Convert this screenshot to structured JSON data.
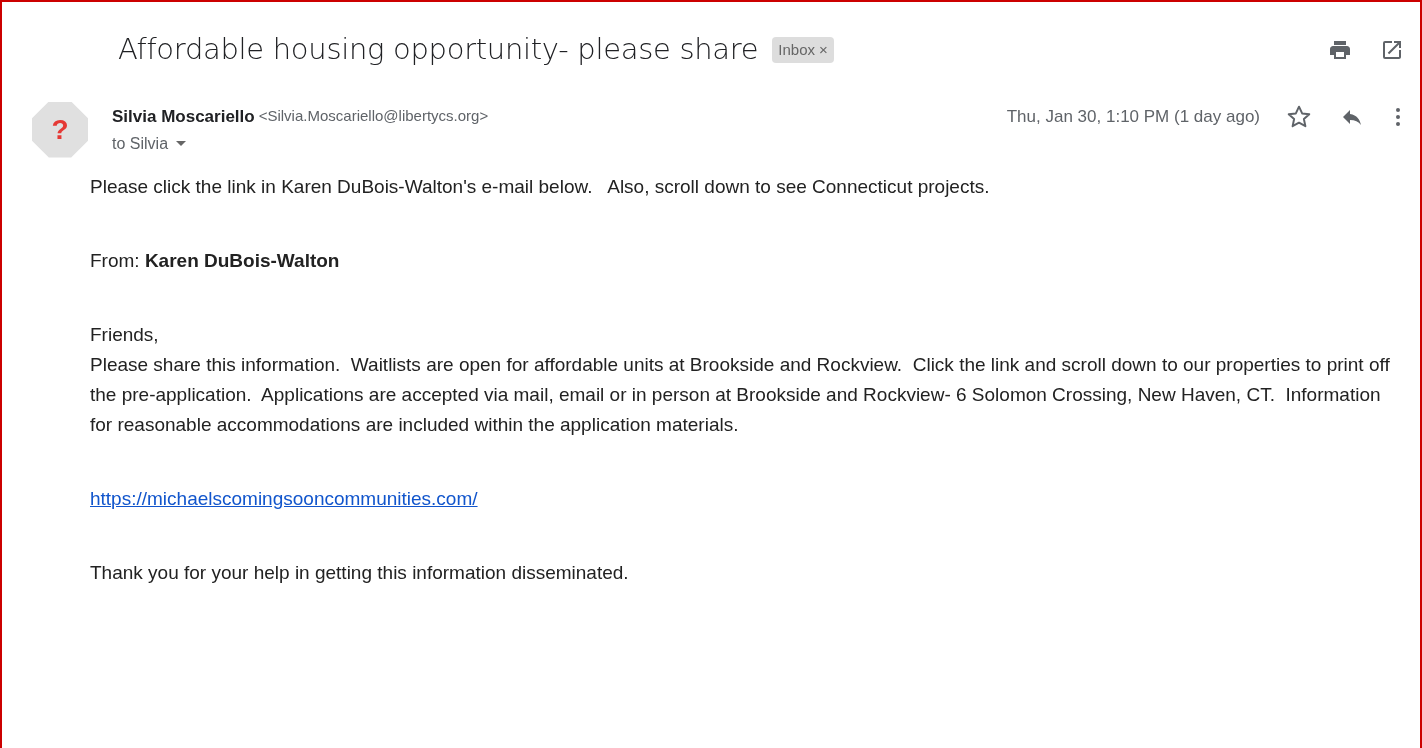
{
  "subject": "Affordable housing opportunity- please share",
  "labels": [
    {
      "text": "Inbox",
      "close": "×"
    }
  ],
  "sender": {
    "name": "Silvia Moscariello",
    "email": "<Silvia.Moscariello@libertycs.org>",
    "avatar": "?",
    "recipients": "to Silvia"
  },
  "date": "Thu, Jan 30, 1:10 PM (1 day ago)",
  "starred": false,
  "body": [
    {
      "kind": "text",
      "text": "Please click the link in Karen DuBois-Walton's e-mail below.   Also, scroll down to see Connecticut projects."
    },
    {
      "kind": "text",
      "text": "From: **Karen DuBois-Walton**"
    },
    {
      "kind": "text",
      "text": "Friends,\nPlease share this information.  Waitlists are open for affordable units at Brookside and Rockview.  Click the link and scroll down to our properties to print off the pre-application.  Applications are accepted via mail, email or in person at Brookside and Rockview- 6 Solomon Crossing, New Haven, CT.  Information for reasonable accommodations are included within the application materials."
    },
    {
      "kind": "link",
      "text": "https://michaelscomingsooncommunities.com/"
    },
    {
      "kind": "text",
      "text": "Thank you for your help in getting this information disseminated."
    }
  ]
}
